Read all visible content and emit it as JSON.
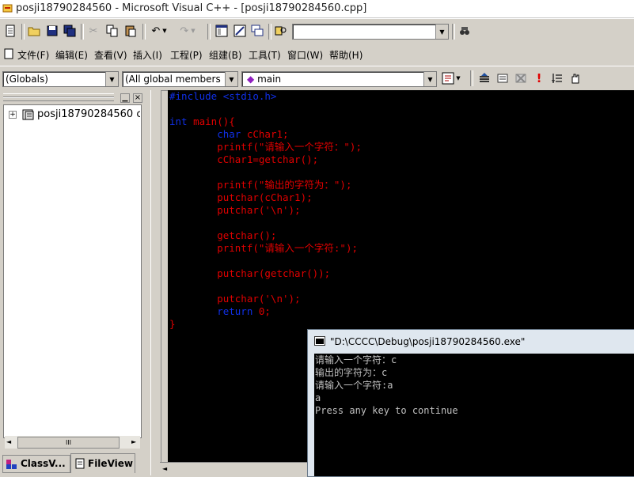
{
  "window": {
    "title": "posji18790284560 - Microsoft Visual C++ - [posji18790284560.cpp]"
  },
  "menu": {
    "items": [
      "文件(F)",
      "编辑(E)",
      "查看(V)",
      "插入(I)",
      "工程(P)",
      "组建(B)",
      "工具(T)",
      "窗口(W)",
      "帮助(H)"
    ]
  },
  "wizardbar": {
    "scope": "(Globals)",
    "members": "(All global members",
    "function": "main"
  },
  "workspace": {
    "tree_root": "posji18790284560 c",
    "tabs": [
      "ClassV...",
      "FileView"
    ],
    "scroll_grip": "III"
  },
  "editor": {
    "lines": [
      {
        "text": "#include <stdio.h>",
        "color": "blue"
      },
      {
        "text": "",
        "color": "red"
      },
      {
        "text": "int main(){",
        "color": "mixed"
      },
      {
        "text": "        char cChar1;",
        "color": "mixed"
      },
      {
        "text": "        printf(\"请输入一个字符：\");",
        "color": "red"
      },
      {
        "text": "        cChar1=getchar();",
        "color": "red"
      },
      {
        "text": "",
        "color": "red"
      },
      {
        "text": "        printf(\"输出的字符为：\");",
        "color": "red"
      },
      {
        "text": "        putchar(cChar1);",
        "color": "red"
      },
      {
        "text": "        putchar('\\n');",
        "color": "red"
      },
      {
        "text": "",
        "color": "red"
      },
      {
        "text": "        getchar();",
        "color": "red"
      },
      {
        "text": "        printf(\"请输入一个字符:\");",
        "color": "red"
      },
      {
        "text": "",
        "color": "red"
      },
      {
        "text": "        putchar(getchar());",
        "color": "red"
      },
      {
        "text": "",
        "color": "red"
      },
      {
        "text": "        putchar('\\n');",
        "color": "red"
      },
      {
        "text": "        return 0;",
        "color": "mixed"
      },
      {
        "text": "}",
        "color": "red"
      }
    ]
  },
  "console": {
    "title": "\"D:\\CCCC\\Debug\\posji18790284560.exe\"",
    "lines": [
      "请输入一个字符：c",
      "输出的字符为：c",
      "请输入一个字符:a",
      "a",
      "Press any key to continue"
    ]
  },
  "colors": {
    "code_red": "#e00000",
    "keyword_blue": "#1030e8",
    "editor_bg": "#000000"
  }
}
